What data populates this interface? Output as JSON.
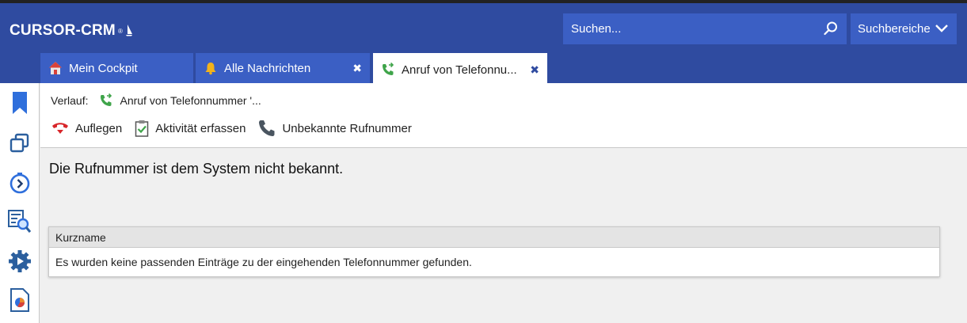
{
  "brand": {
    "name": "CURSOR-CRM",
    "mark": "®"
  },
  "search": {
    "placeholder": "Suchen...",
    "scope_label": "Suchbereiche"
  },
  "tabs": [
    {
      "label": "Mein Cockpit",
      "icon": "home-icon",
      "closable": false,
      "active": false
    },
    {
      "label": "Alle Nachrichten",
      "icon": "bell-icon",
      "closable": true,
      "active": false
    },
    {
      "label": "Anruf von Telefonnu...",
      "icon": "incoming-call-icon",
      "closable": true,
      "active": true
    }
  ],
  "close_glyph": "✖",
  "sidebar": [
    {
      "icon": "bookmark-icon"
    },
    {
      "icon": "windows-icon"
    },
    {
      "icon": "history-icon"
    },
    {
      "icon": "search-list-icon"
    },
    {
      "icon": "settings-play-icon"
    },
    {
      "icon": "report-icon"
    }
  ],
  "history": {
    "label": "Verlauf:",
    "item": "Anruf von Telefonnummer '..."
  },
  "actions": [
    {
      "label": "Auflegen",
      "icon": "hang-up-icon"
    },
    {
      "label": "Aktivität erfassen",
      "icon": "clipboard-check-icon"
    },
    {
      "label": "Unbekannte Rufnummer",
      "icon": "phone-icon"
    }
  ],
  "message": "Die Rufnummer ist dem System nicht bekannt.",
  "grid": {
    "columns": [
      "Kurzname"
    ],
    "empty_text": "Es wurden keine passenden Einträge zu der eingehenden Telefonnummer gefunden."
  },
  "colors": {
    "header": "#2f4ba0",
    "tab_inactive": "#3b5fc4",
    "accent_blue": "#2f6fdc"
  }
}
